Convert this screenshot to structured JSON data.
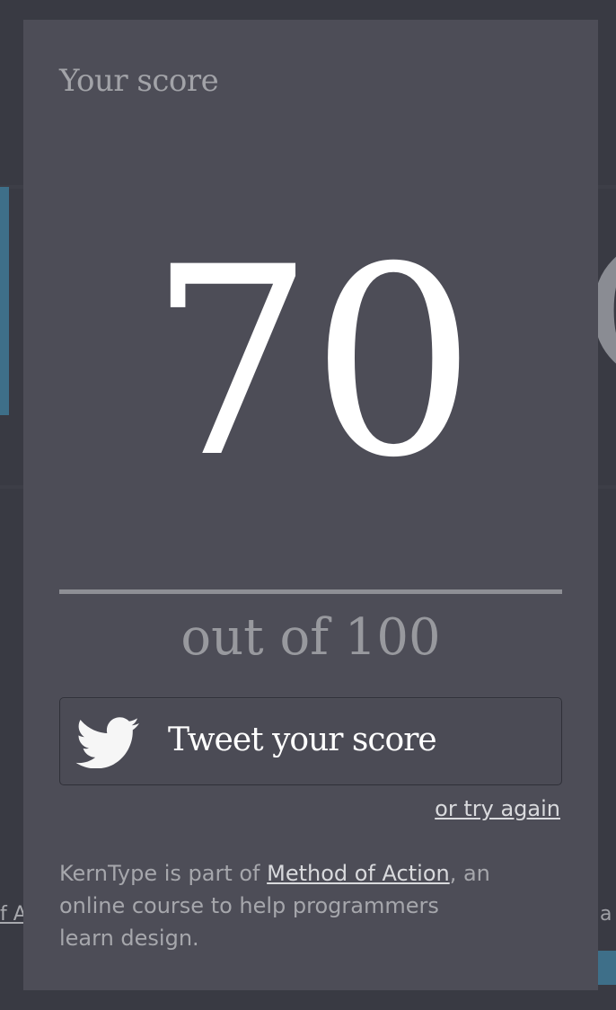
{
  "modal": {
    "title": "Your score",
    "score": "70",
    "out_of": "out of 100",
    "tweet_label": "Tweet your score",
    "try_again": "or try again",
    "footer": {
      "prefix": "KernType is part of ",
      "link": "Method of Action",
      "suffix_line1": ", an",
      "line2": "online course to help programmers",
      "line3": "learn design."
    }
  },
  "background": {
    "left_fragment": "f A",
    "right_fragment": "a",
    "right_letter": "O"
  },
  "colors": {
    "page_bg": "#393a43",
    "modal_bg": "#4d4d57",
    "accent_blue": "#3e6f89",
    "muted_text": "#a2a3a8",
    "score_text": "#ffffff"
  }
}
